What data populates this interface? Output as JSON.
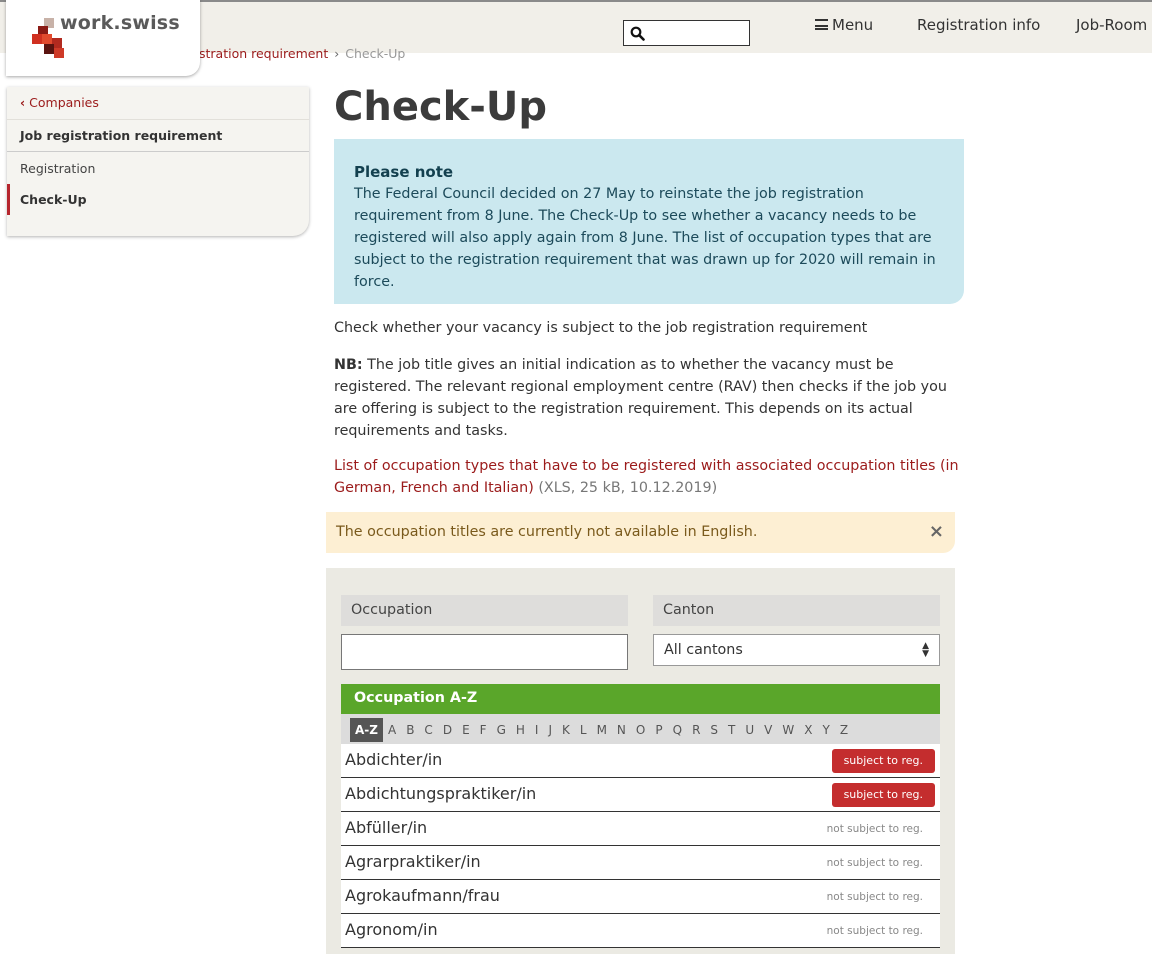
{
  "header": {
    "logo_text": "work.swiss",
    "nav": {
      "menu": "Menu",
      "registration_info": "Registration info",
      "job_room": "Job-Room"
    }
  },
  "breadcrumb": {
    "parent": "stration requirement",
    "current": "Check-Up"
  },
  "sidebar": {
    "back": "Companies",
    "section": "Job registration requirement",
    "items": [
      {
        "label": "Registration"
      },
      {
        "label": "Check-Up"
      }
    ]
  },
  "main": {
    "title": "Check-Up",
    "note": {
      "title": "Please note",
      "text": "The Federal Council decided on 27 May to reinstate the job registration requirement from 8 June. The Check-Up to see whether a vacancy needs to be registered will also apply again from 8 June. The list of occupation types that are subject to the registration requirement that was drawn up for 2020 will remain in force."
    },
    "intro": "Check whether your vacancy is subject to the job registration requirement",
    "nb_label": "NB:",
    "nb_text": " The job title gives an initial indication as to whether the vacancy must be registered. The relevant regional employment centre (RAV) then checks if the job you are offering is subject to the registration requirement. This depends on its actual requirements and tasks.",
    "xls_link": "List of occupation types that have to be registered with associated occupation titles (in German, French and Italian)",
    "xls_meta": " (XLS, 25 kB, 10.12.2019)",
    "alert": "The occupation titles are currently not available in English.",
    "alert_close": "×"
  },
  "search": {
    "occupation_label": "Occupation",
    "occupation_value": "",
    "canton_label": "Canton",
    "canton_value": "All cantons",
    "az_title": "Occupation A-Z",
    "az_letters": [
      "A-Z",
      "A",
      "B",
      "C",
      "D",
      "E",
      "F",
      "G",
      "H",
      "I",
      "J",
      "K",
      "L",
      "M",
      "N",
      "O",
      "P",
      "Q",
      "R",
      "S",
      "T",
      "U",
      "V",
      "W",
      "X",
      "Y",
      "Z"
    ],
    "az_active": "A-Z",
    "rows": [
      {
        "name": "Abdichter/in",
        "status": "subject to reg.",
        "subject": true
      },
      {
        "name": "Abdichtungspraktiker/in",
        "status": "subject to reg.",
        "subject": true
      },
      {
        "name": "Abfüller/in",
        "status": "not subject to reg.",
        "subject": false
      },
      {
        "name": "Agrarpraktiker/in",
        "status": "not subject to reg.",
        "subject": false
      },
      {
        "name": "Agrokaufmann/frau",
        "status": "not subject to reg.",
        "subject": false
      },
      {
        "name": "Agronom/in",
        "status": "not subject to reg.",
        "subject": false
      }
    ]
  },
  "colors": {
    "accent_red": "#9b1b1b",
    "badge_red": "#c42d2e",
    "az_green": "#5aa62a",
    "note_blue": "#cbe8ef",
    "alert_yellow": "#fdefd3"
  }
}
